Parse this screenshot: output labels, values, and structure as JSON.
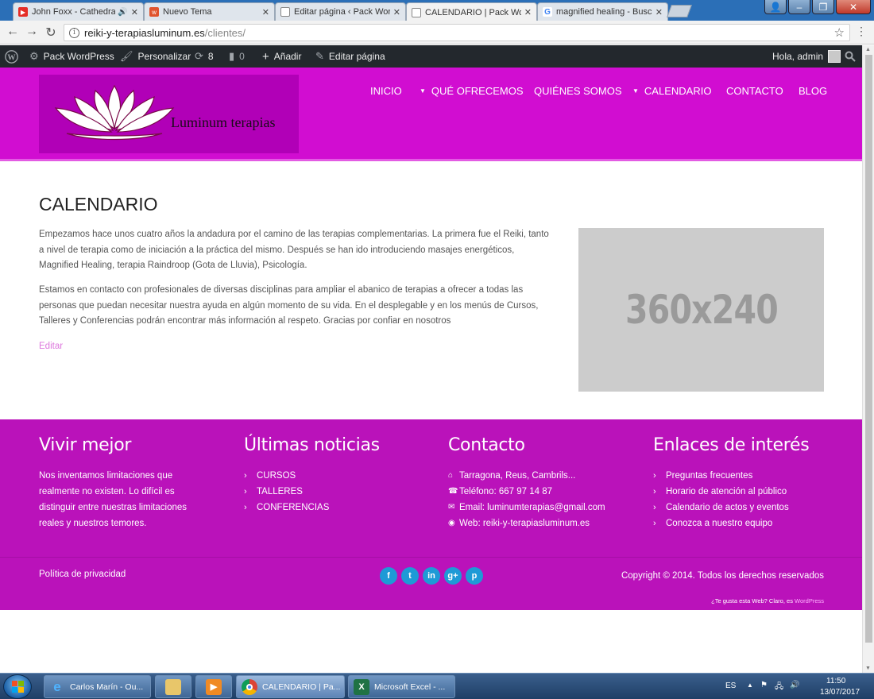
{
  "browser": {
    "tabs": [
      {
        "title": "John Foxx - Cathedral",
        "icon": "youtube-icon",
        "audio": true,
        "active": false
      },
      {
        "title": "Nuevo Tema",
        "icon": "wix-icon",
        "audio": false,
        "active": false
      },
      {
        "title": "Editar página ‹ Pack Wor",
        "icon": "page-icon",
        "audio": false,
        "active": false
      },
      {
        "title": "CALENDARIO | Pack Wor",
        "icon": "page-icon",
        "audio": false,
        "active": true
      },
      {
        "title": "magnified healing - Busc",
        "icon": "google-icon",
        "audio": false,
        "active": false
      }
    ],
    "url_host": "reiki-y-terapiasluminum.es",
    "url_path": "/clientes/"
  },
  "adminbar": {
    "site_name": "Pack WordPress",
    "customize": "Personalizar",
    "updates_count": "8",
    "comments_count": "0",
    "add_new": "Añadir",
    "edit_page": "Editar página",
    "greeting": "Hola, admin"
  },
  "site": {
    "logo_text": "Luminum terapias",
    "nav": [
      {
        "label": "INICIO",
        "dropdown": false
      },
      {
        "label": "QUÉ OFRECEMOS",
        "dropdown": true
      },
      {
        "label": "QUIÉNES SOMOS",
        "dropdown": false
      },
      {
        "label": "CALENDARIO",
        "dropdown": true
      },
      {
        "label": "CONTACTO",
        "dropdown": false
      },
      {
        "label": "BLOG",
        "dropdown": false
      }
    ]
  },
  "content": {
    "title": "CALENDARIO",
    "paragraph1": "Empezamos hace unos cuatro años la andadura por el camino de las terapias complementarias. La primera fue el Reiki, tanto a nivel de terapia como de iniciación  a la práctica del mismo. Después se han ido introduciendo masajes energéticos,  Magnified Healing, terapia Raindroop (Gota de Lluvia), Psicología.",
    "paragraph2": "Estamos en contacto con profesionales de diversas disciplinas para ampliar el abanico de terapias a ofrecer a todas las personas que puedan necesitar nuestra ayuda en algún momento de su vida. En el desplegable y en los menús de Cursos, Talleres y Conferencias podrán encontrar más información al respeto. Gracias por confiar en nosotros",
    "edit_link": "Editar",
    "image_placeholder": "360x240"
  },
  "footer": {
    "col1_title": "Vivir mejor",
    "col1_text": "Nos inventamos limitaciones que realmente no existen. Lo difícil es distinguir entre nuestras limitaciones reales y nuestros temores.",
    "col2_title": "Últimas noticias",
    "col2_items": [
      "CURSOS",
      "TALLERES",
      "CONFERENCIAS"
    ],
    "col3_title": "Contacto",
    "contact": {
      "address": "Tarragona, Reus, Cambrils...",
      "phone": "Teléfono: 667 97 14 87",
      "email": "Email: luminumterapias@gmail.com",
      "web": "Web: reiki-y-terapiasluminum.es"
    },
    "col4_title": "Enlaces de interés",
    "col4_items": [
      "Preguntas frecuentes",
      "Horario de atención al público",
      "Calendario de actos y eventos",
      "Conozca a nuestro equipo"
    ],
    "privacy": "Política de privacidad",
    "copyright": "Copyright © 2014. Todos los derechos reservados",
    "credit_text": "¿Te gusta esta Web? Claro, es ",
    "credit_link": "WordPress"
  },
  "taskbar": {
    "items": [
      {
        "label": "Carlos Marín - Ou...",
        "icon": "ie-icon"
      },
      {
        "label": "",
        "icon": "explorer-icon"
      },
      {
        "label": "",
        "icon": "media-player-icon"
      },
      {
        "label": "CALENDARIO | Pa...",
        "icon": "chrome-icon"
      },
      {
        "label": "Microsoft Excel - ...",
        "icon": "excel-icon"
      }
    ],
    "language": "ES",
    "time": "11:50",
    "date": "13/07/2017"
  },
  "colors": {
    "header_magenta": "#d10dd1",
    "footer_magenta": "#ba12ba",
    "adminbar": "#23282d",
    "edit_link": "#dd77dd",
    "social_blue": "#1e9ad6"
  }
}
